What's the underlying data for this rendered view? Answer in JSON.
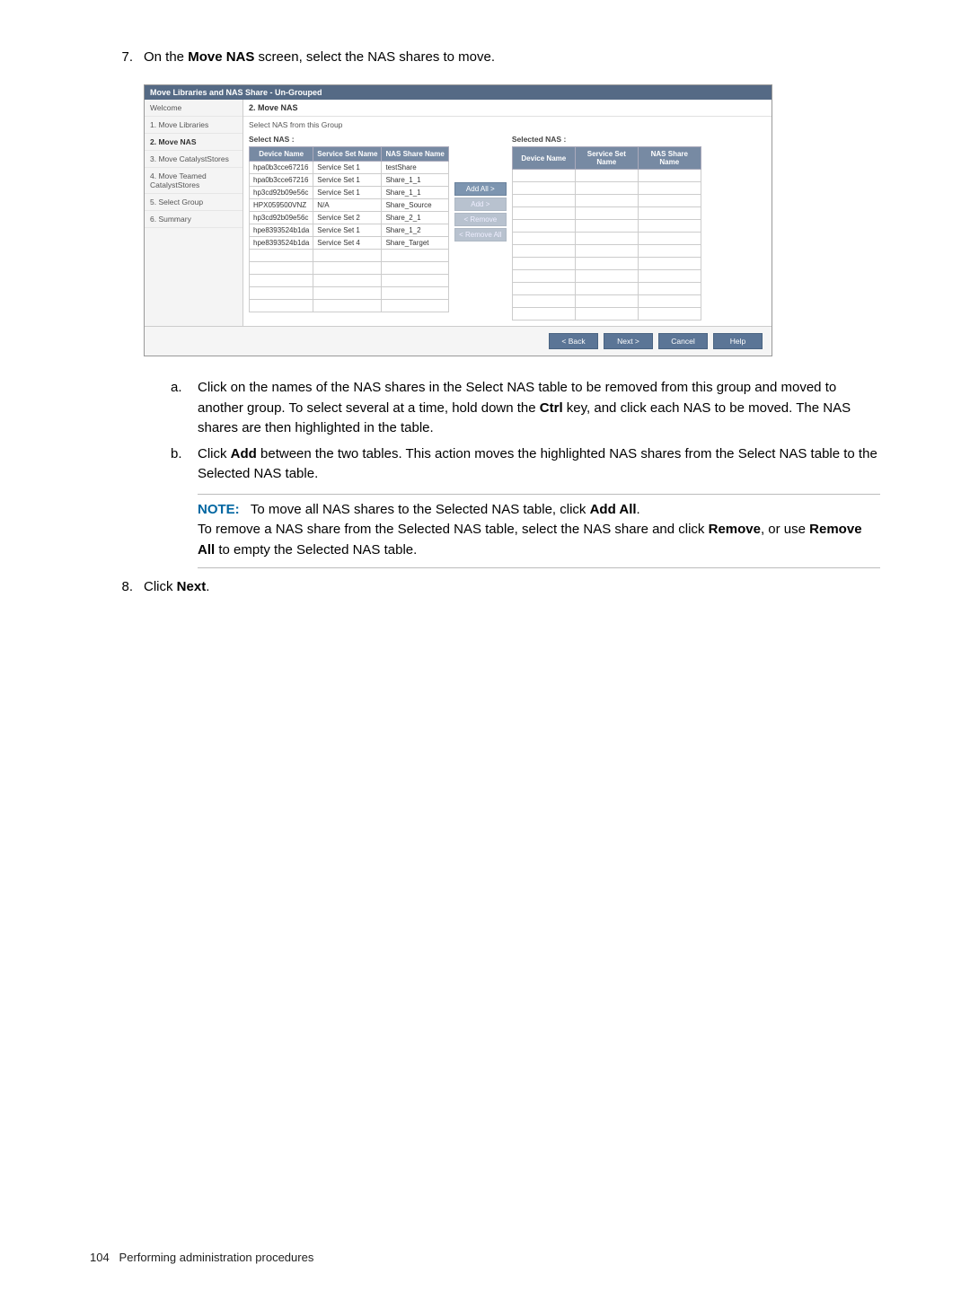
{
  "step7": {
    "num": "7.",
    "text_pre": "On the ",
    "bold": "Move NAS",
    "text_post": " screen, select the NAS shares to move."
  },
  "wizard": {
    "title": "Move Libraries and NAS Share - Un-Grouped",
    "sidebar": {
      "items": [
        "Welcome",
        "1. Move Libraries",
        "2. Move NAS",
        "3. Move CatalystStores",
        "4. Move Teamed CatalystStores",
        "5. Select Group",
        "6. Summary"
      ],
      "active_index": 2
    },
    "panel": {
      "heading": "2. Move NAS",
      "subtext": "Select NAS from this Group",
      "left_label": "Select NAS :",
      "right_label": "Selected NAS :",
      "headers": [
        "Device Name",
        "Service Set Name",
        "NAS Share Name"
      ],
      "rows": [
        {
          "device": "hpa0b3cce67216",
          "set": "Service Set 1",
          "share": "testShare"
        },
        {
          "device": "hpa0b3cce67216",
          "set": "Service Set 1",
          "share": "Share_1_1"
        },
        {
          "device": "hp3cd92b09e56c",
          "set": "Service Set 1",
          "share": "Share_1_1"
        },
        {
          "device": "HPX059500VNZ",
          "set": "N/A",
          "share": "Share_Source"
        },
        {
          "device": "hp3cd92b09e56c",
          "set": "Service Set 2",
          "share": "Share_2_1"
        },
        {
          "device": "hpe8393524b1da",
          "set": "Service Set 1",
          "share": "Share_1_2"
        },
        {
          "device": "hpe8393524b1da",
          "set": "Service Set 4",
          "share": "Share_Target"
        }
      ],
      "buttons": {
        "add_all": "Add All >",
        "add": "Add >",
        "remove": "< Remove",
        "remove_all": "< Remove All"
      }
    },
    "footer": {
      "back": "< Back",
      "next": "Next >",
      "cancel": "Cancel",
      "help": "Help"
    }
  },
  "substeps": {
    "a": {
      "marker": "a.",
      "text_1": "Click on the names of the NAS shares in the Select NAS table to be removed from this group and moved to another group. To select several at a time, hold down the ",
      "bold": "Ctrl",
      "text_2": " key, and click each NAS to be moved. The NAS shares are then highlighted in the table."
    },
    "b": {
      "marker": "b.",
      "text_1": "Click ",
      "bold": "Add",
      "text_2": " between the two tables. This action moves the highlighted NAS shares from the Select NAS table to the Selected NAS table."
    }
  },
  "note": {
    "label": "NOTE:",
    "line1_pre": "To move all NAS shares to the Selected NAS table, click ",
    "line1_bold": "Add All",
    "line1_post": ".",
    "line2_pre": "To remove a NAS share from the Selected NAS table, select the NAS share and click ",
    "line2_bold1": "Remove",
    "line2_mid": ", or use ",
    "line2_bold2": "Remove All",
    "line2_post": " to empty the Selected NAS table."
  },
  "step8": {
    "num": "8.",
    "pre": "Click ",
    "bold": "Next",
    "post": "."
  },
  "footer": {
    "page": "104",
    "text": "Performing administration procedures"
  }
}
